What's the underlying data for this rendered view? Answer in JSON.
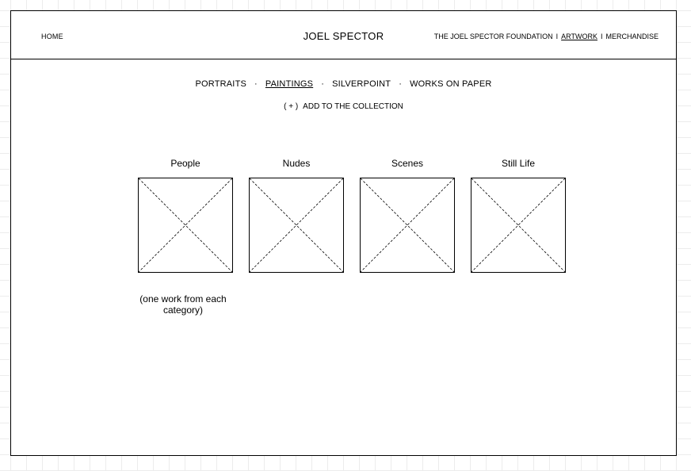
{
  "header": {
    "home_label": "HOME",
    "site_title": "JOEL SPECTOR",
    "nav": [
      {
        "label": "THE JOEL SPECTOR FOUNDATION",
        "active": false
      },
      {
        "label": "ARTWORK",
        "active": true
      },
      {
        "label": "MERCHANDISE",
        "active": false
      }
    ],
    "nav_separator": "I"
  },
  "subnav": {
    "items": [
      {
        "label": "PORTRAITS",
        "active": false
      },
      {
        "label": "PAINTINGS",
        "active": true
      },
      {
        "label": "SILVERPOINT",
        "active": false
      },
      {
        "label": "WORKS ON PAPER",
        "active": false
      }
    ],
    "separator": "·"
  },
  "collection": {
    "plus": "( + )",
    "label": "ADD TO THE COLLECTION"
  },
  "categories": [
    {
      "label": "People"
    },
    {
      "label": "Nudes"
    },
    {
      "label": "Scenes"
    },
    {
      "label": "Still Life"
    }
  ],
  "note": "(one work from each category)"
}
